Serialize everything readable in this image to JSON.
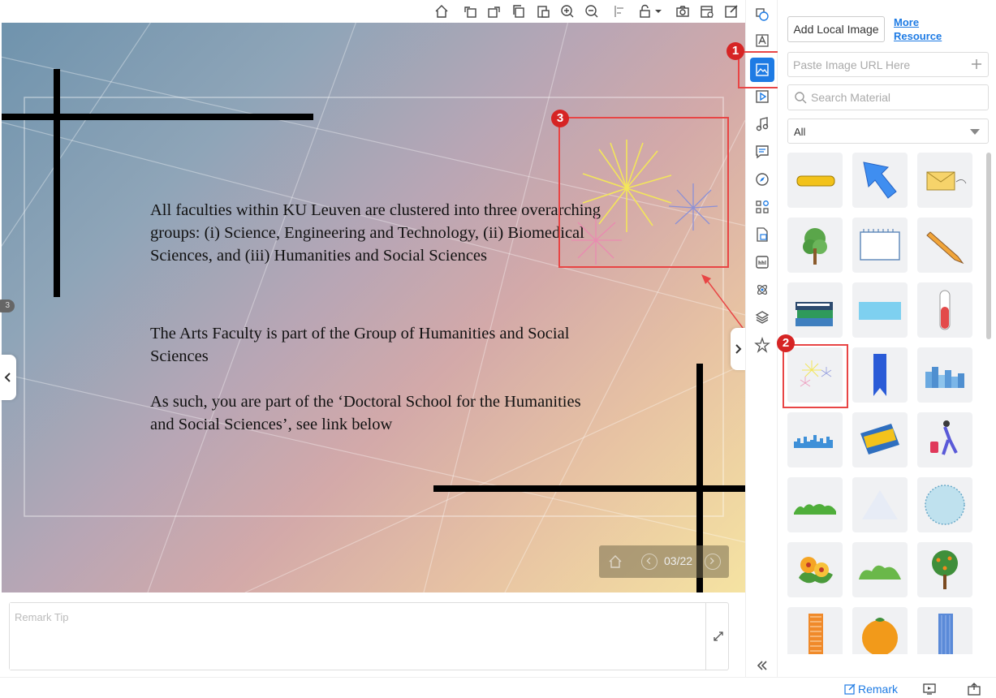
{
  "slide": {
    "paragraphs": [
      "All faculties within KU Leuven are clustered into three overarching groups: (i) Science, Engineering and Technology, (ii) Biomedical Sciences, and (iii) Humanities and Social Sciences",
      "The Arts Faculty is part of the Group of Humanities and Social Sciences",
      "As such, you are part of the ‘Doctoral School for the Humanities and Social Sciences’, see link below"
    ],
    "page_indicator": "03/22",
    "left_pill": "3"
  },
  "annotations": {
    "badge1": "1",
    "badge2": "2",
    "badge3": "3"
  },
  "remark": {
    "placeholder": "Remark Tip"
  },
  "panel": {
    "add_local_label": "Add Local Image",
    "more_resource_label": "More Resource",
    "url_placeholder": "Paste Image URL Here",
    "search_placeholder": "Search Material",
    "filter_value": "All",
    "tiles": [
      "yellow-bar",
      "blue-cursor",
      "envelope",
      "tree",
      "notepad",
      "pencil",
      "books",
      "blue-rectangle",
      "test-tube",
      "fireworks",
      "bookmark",
      "city-skyline",
      "blue-skyline",
      "wallet",
      "traveler",
      "grass",
      "triangle",
      "dotted-circle",
      "flowers",
      "bush",
      "orange-tree",
      "orange-building",
      "orange-fruit",
      "blue-building"
    ]
  },
  "statusbar": {
    "remark_label": "Remark"
  },
  "colors": {
    "accent": "#1e7be4",
    "annotation": "#e84545"
  }
}
